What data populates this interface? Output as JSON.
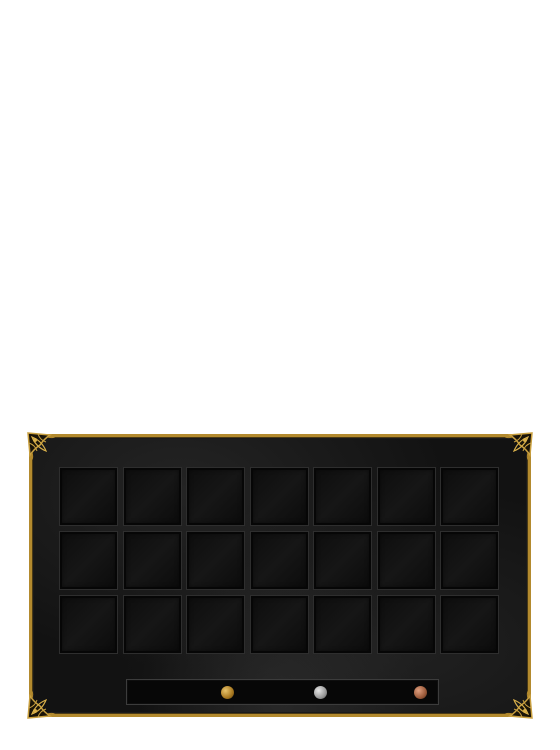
{
  "inventory": {
    "rows": 3,
    "columns": 7,
    "slots_filled": 0
  },
  "currency": {
    "coins": [
      {
        "name": "gold-coin",
        "color": "#c8962a"
      },
      {
        "name": "silver-coin",
        "color": "#b8b8b8"
      },
      {
        "name": "copper-coin",
        "color": "#b06a48"
      }
    ]
  },
  "navigation": {
    "prev_icon": "chevron-left-icon",
    "next_icon": "chevron-right-icon"
  },
  "theme": {
    "frame_color": "#b38a2e",
    "panel_color": "#121212"
  }
}
